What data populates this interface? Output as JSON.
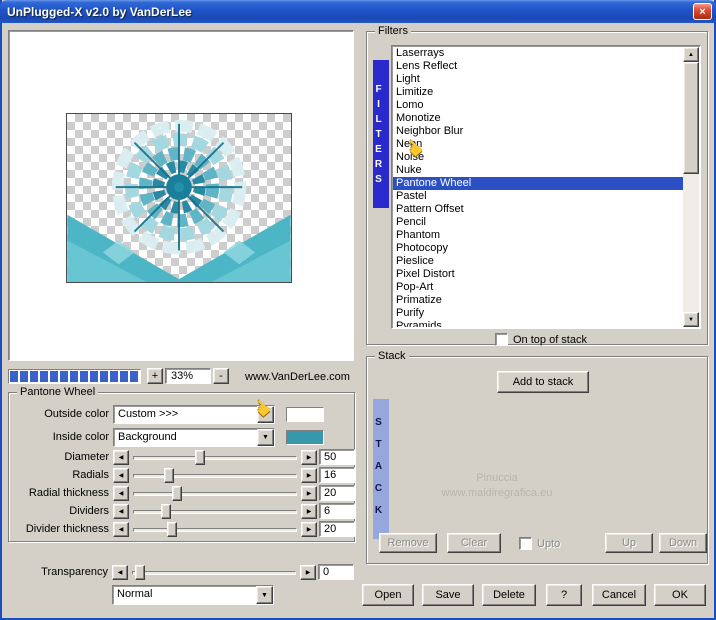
{
  "colors": {
    "selection": "#2B50C4",
    "filters_bar": "#2929CC",
    "stack_bar": "#96A7DE",
    "inside_swatch": "#3797AB",
    "outside_swatch": "#FFFFFF",
    "progress_fill": "#3A62C8"
  },
  "window": {
    "title": "UnPlugged-X v2.0 by VanDerLee"
  },
  "icons": {
    "close": "×",
    "hand": "☚",
    "combo_arrow": "▼",
    "scroll_up": "▲",
    "scroll_down": "▼",
    "slider_left": "◀",
    "slider_right": "▶"
  },
  "preview": {
    "zoom_in_label": "+",
    "zoom_out_label": "-",
    "zoom_value": "33%",
    "website": "www.VanDerLee.com"
  },
  "filters": {
    "group_label": "Filters",
    "vertical_label": "FILTERS",
    "items": [
      "Laserrays",
      "Lens Reflect",
      "Light",
      "Limitize",
      "Lomo",
      "Monotize",
      "Neighbor Blur",
      "Neon",
      "Noise",
      "Nuke",
      "Pantone Wheel",
      "Pastel",
      "Pattern Offset",
      "Pencil",
      "Phantom",
      "Photocopy",
      "Pieslice",
      "Pixel Distort",
      "Pop-Art",
      "Primatize",
      "Purify",
      "Pyramids"
    ],
    "selected_index": 10,
    "selected": "Pantone Wheel",
    "on_top_label": "On top of stack"
  },
  "settings": {
    "group_label": "Pantone Wheel",
    "outside_color_label": "Outside color",
    "outside_color_value": "Custom >>>",
    "inside_color_label": "Inside color",
    "inside_color_value": "Background",
    "sliders": [
      {
        "label": "Diameter",
        "value": "50",
        "pos": "38%"
      },
      {
        "label": "Radials",
        "value": "16",
        "pos": "19%"
      },
      {
        "label": "Radial thickness",
        "value": "20",
        "pos": "24%"
      },
      {
        "label": "Dividers",
        "value": "6",
        "pos": "17%"
      },
      {
        "label": "Divider thickness",
        "value": "20",
        "pos": "21%"
      }
    ],
    "transparency_label": "Transparency",
    "transparency_value": "0",
    "transparency_pos": "2%",
    "blend_mode": "Normal"
  },
  "stack": {
    "group_label": "Stack",
    "vertical_label": "STACK",
    "add_label": "Add to stack",
    "remove_label": "Remove",
    "clear_label": "Clear",
    "upto_label": "Upto",
    "up_label": "Up",
    "down_label": "Down",
    "watermark_line1": "Pinuccia",
    "watermark_line2": "www.maidiregrafica.eu"
  },
  "buttons": {
    "open": "Open",
    "save": "Save",
    "delete": "Delete",
    "help": "?",
    "cancel": "Cancel",
    "ok": "OK"
  }
}
